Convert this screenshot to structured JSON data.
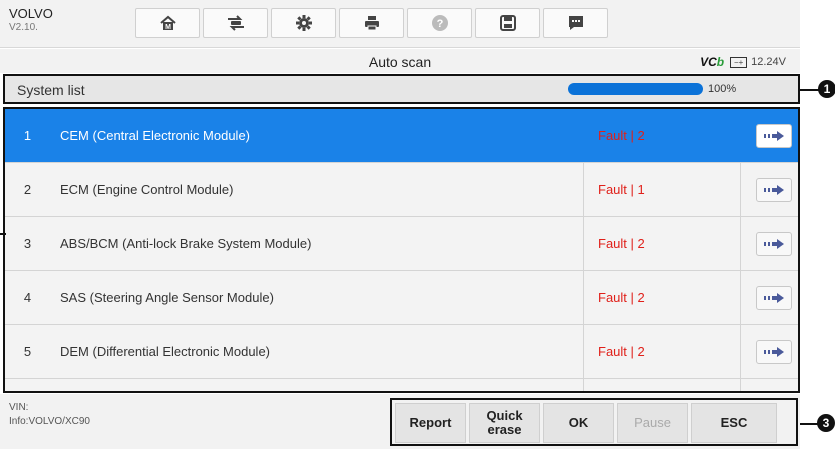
{
  "header": {
    "make": "VOLVO",
    "version": "V2.10."
  },
  "toolbar": {
    "items": [
      {
        "name": "home-icon"
      },
      {
        "name": "vehicle-swap-icon"
      },
      {
        "name": "settings-icon"
      },
      {
        "name": "print-icon"
      },
      {
        "name": "help-icon"
      },
      {
        "name": "save-icon"
      },
      {
        "name": "message-icon"
      }
    ]
  },
  "title": "Auto scan",
  "vci": {
    "label_a": "VC",
    "label_b": "b",
    "voltage": "12.24V"
  },
  "system_list": {
    "label": "System list",
    "progress_pct": 100,
    "progress_text": "100%"
  },
  "rows": [
    {
      "num": "1",
      "name": "CEM (Central Electronic Module)",
      "status": "Fault | 2",
      "selected": true
    },
    {
      "num": "2",
      "name": "ECM (Engine Control Module)",
      "status": "Fault | 1",
      "selected": false
    },
    {
      "num": "3",
      "name": "ABS/BCM (Anti-lock Brake System Module)",
      "status": "Fault | 2",
      "selected": false
    },
    {
      "num": "4",
      "name": "SAS (Steering Angle Sensor Module)",
      "status": "Fault | 2",
      "selected": false
    },
    {
      "num": "5",
      "name": "DEM (Differential Electronic Module)",
      "status": "Fault | 2",
      "selected": false
    }
  ],
  "footer": {
    "vin_label": "VIN:",
    "info": "Info:VOLVO/XC90",
    "buttons": {
      "report": "Report",
      "quick_erase_1": "Quick",
      "quick_erase_2": "erase",
      "ok": "OK",
      "pause": "Pause",
      "esc": "ESC"
    }
  },
  "callouts": {
    "one": "1",
    "three": "3"
  },
  "colors": {
    "accent": "#1a82e8",
    "fault": "#e0201a",
    "progress": "#0b72d8"
  }
}
